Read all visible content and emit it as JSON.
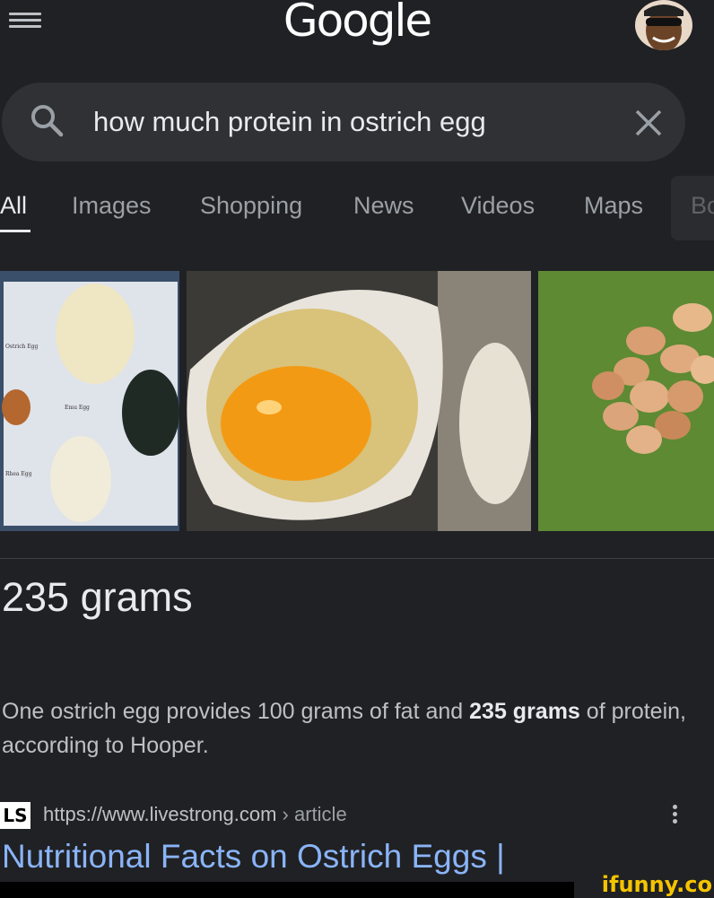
{
  "header": {
    "logo_text": "Google",
    "menu_icon": "hamburger-menu-icon",
    "avatar_icon": "account-avatar"
  },
  "search": {
    "query": "how much protein in ostrich egg",
    "search_icon": "search-icon",
    "clear_icon": "close-icon"
  },
  "tabs": [
    {
      "label": "All",
      "active": true
    },
    {
      "label": "Images",
      "active": false
    },
    {
      "label": "Shopping",
      "active": false
    },
    {
      "label": "News",
      "active": false
    },
    {
      "label": "Videos",
      "active": false
    },
    {
      "label": "Maps",
      "active": false
    },
    {
      "label": "Bo",
      "active": false
    }
  ],
  "image_strip": {
    "tiles": [
      {
        "subject": "ostrich egg size comparison with other eggs",
        "labels": [
          "Ostrich Egg",
          "Emu Egg",
          "Rhea Egg"
        ]
      },
      {
        "subject": "ostrich egg cracked into a bowl"
      },
      {
        "subject": "pile of eggs on grass"
      }
    ]
  },
  "featured_snippet": {
    "answer": "235 grams",
    "text_before": "One ostrich egg provides 100 grams of fat and ",
    "text_bold": "235 grams",
    "text_after": " of protein, according to Hooper."
  },
  "result": {
    "favicon_text": "LS",
    "url": "https://www.livestrong.com",
    "breadcrumb": " › article",
    "title": "Nutritional Facts on Ostrich Eggs |",
    "menu_icon": "more-vert-icon"
  },
  "watermark": "ifunny.co",
  "colors": {
    "background": "#202124",
    "searchbox": "#303134",
    "link": "#8ab4f8",
    "text": "#e8eaed",
    "muted": "#9aa0a6",
    "watermark": "#f5c400"
  }
}
